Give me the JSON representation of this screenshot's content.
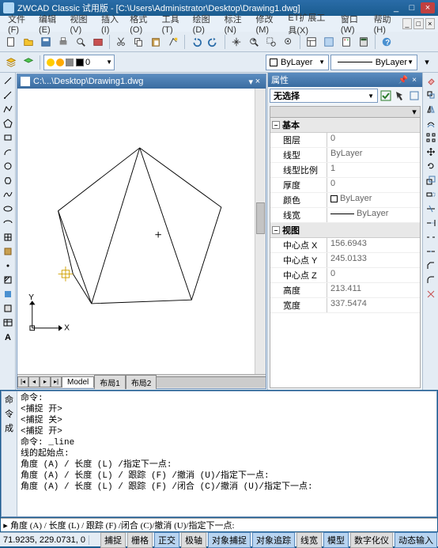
{
  "app": {
    "title": "ZWCAD Classic 试用版 - [C:\\Users\\Administrator\\Desktop\\Drawing1.dwg]"
  },
  "menu": [
    "文件(F)",
    "编辑(E)",
    "视图(V)",
    "插入(I)",
    "格式(O)",
    "工具(T)",
    "绘图(D)",
    "标注(N)",
    "修改(M)",
    "ET扩展工具(X)",
    "窗口(W)",
    "帮助(H)"
  ],
  "layer": {
    "name": "0"
  },
  "bylayer": {
    "label": "ByLayer"
  },
  "doc": {
    "title": "C:\\...\\Desktop\\Drawing1.dwg"
  },
  "modeltabs": {
    "model": "Model",
    "layout1": "布局1",
    "layout2": "布局2"
  },
  "prop": {
    "title": "属性",
    "selection": "无选择",
    "groups": {
      "basic": "基本",
      "view": "视图"
    },
    "rows": {
      "layer": {
        "n": "图层",
        "v": "0"
      },
      "linetype": {
        "n": "线型",
        "v": "ByLayer"
      },
      "ltscale": {
        "n": "线型比例",
        "v": "1"
      },
      "thickness": {
        "n": "厚度",
        "v": "0"
      },
      "color": {
        "n": "颜色",
        "v": "ByLayer"
      },
      "lineweight": {
        "n": "线宽",
        "v": "ByLayer"
      },
      "cx": {
        "n": "中心点 X",
        "v": "156.6943"
      },
      "cy": {
        "n": "中心点 Y",
        "v": "245.0133"
      },
      "cz": {
        "n": "中心点 Z",
        "v": "0"
      },
      "height": {
        "n": "高度",
        "v": "213.411"
      },
      "width": {
        "n": "宽度",
        "v": "337.5474"
      }
    }
  },
  "cmd": {
    "history": "命令:\n<捕捉 开>\n<捕捉 关>\n<捕捉 开>\n命令: _line\n线的起始点:\n角度 (A) / 长度 (L) /指定下一点:\n角度 (A) / 长度 (L) / 跟踪 (F) /撤消 (U)/指定下一点:\n角度 (A) / 长度 (L) / 跟踪 (F) /闭合 (C)/撤消 (U)/指定下一点:",
    "prompt": "角度 (A) / 长度 (L) / 跟踪 (F) /闭合 (C)/撤消 (U)/指定下一点:"
  },
  "status": {
    "coords": "71.9235, 229.0731, 0",
    "buttons": [
      "捕捉",
      "栅格",
      "正交",
      "极轴",
      "对象捕捉",
      "对象追踪",
      "线宽",
      "模型",
      "数字化仪",
      "动态输入"
    ],
    "active": [
      2,
      4,
      5,
      7,
      9
    ]
  },
  "ucs": {
    "x": "X",
    "y": "Y"
  }
}
